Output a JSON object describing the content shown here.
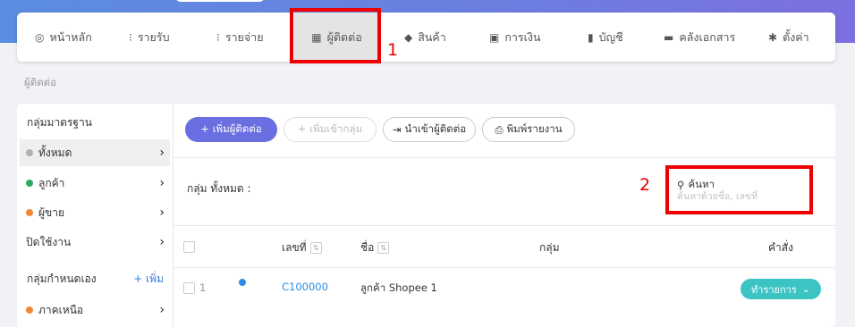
{
  "nav": {
    "items": [
      {
        "label": "หน้าหลัก",
        "icon": "dashboard-icon"
      },
      {
        "label": "รายรับ",
        "icon": "income-icon"
      },
      {
        "label": "รายจ่าย",
        "icon": "expense-icon"
      },
      {
        "label": "ผู้ติดต่อ",
        "icon": "contacts-icon"
      },
      {
        "label": "สินค้า",
        "icon": "box-icon"
      },
      {
        "label": "การเงิน",
        "icon": "money-icon"
      },
      {
        "label": "บัญชี",
        "icon": "book-icon"
      },
      {
        "label": "คลังเอกสาร",
        "icon": "folder-icon"
      },
      {
        "label": "ตั้งค่า",
        "icon": "gear-icon"
      }
    ],
    "active_index": 3
  },
  "annotations": {
    "label1": "1",
    "label2": "2",
    "color": "#ee0000"
  },
  "breadcrumb": "ผู้ติดต่อ",
  "sidebar": {
    "standard_title": "กลุ่มมาตรฐาน",
    "standard_items": [
      {
        "label": "ทั้งหมด",
        "color": "#b0b0b0"
      },
      {
        "label": "ลูกค้า",
        "color": "#2eaa5c"
      },
      {
        "label": "ผู้ขาย",
        "color": "#f0883a"
      },
      {
        "label": "ปิดใช้งาน",
        "color": ""
      }
    ],
    "custom_title": "กลุ่มกำหนดเอง",
    "add_label": "+ เพิ่ม",
    "custom_items": [
      {
        "label": "ภาคเหนือ",
        "color": "#f0883a"
      }
    ]
  },
  "toolbar": {
    "add_contact": "+ เพิ่มผู้ติดต่อ",
    "add_group": "+ เพิ่มเข้ากลุ่ม",
    "import": "นำเข้าผู้ติดต่อ",
    "print": "พิมพ์รายงาน"
  },
  "group_label": "กลุ่ม ทั้งหมด :",
  "search": {
    "label": "ค้นหา",
    "placeholder": "ค้นหาด้วยชื่อ, เลขที่"
  },
  "table": {
    "headers": {
      "number": "เลขที่",
      "name": "ชื่อ",
      "group": "กลุ่ม",
      "action": "คำสั่ง"
    },
    "rows": [
      {
        "index": "1",
        "code": "C100000",
        "name": "ลูกค้า Shopee 1",
        "dot_color": "#2b8de8",
        "action": "ทำรายการ"
      }
    ]
  }
}
